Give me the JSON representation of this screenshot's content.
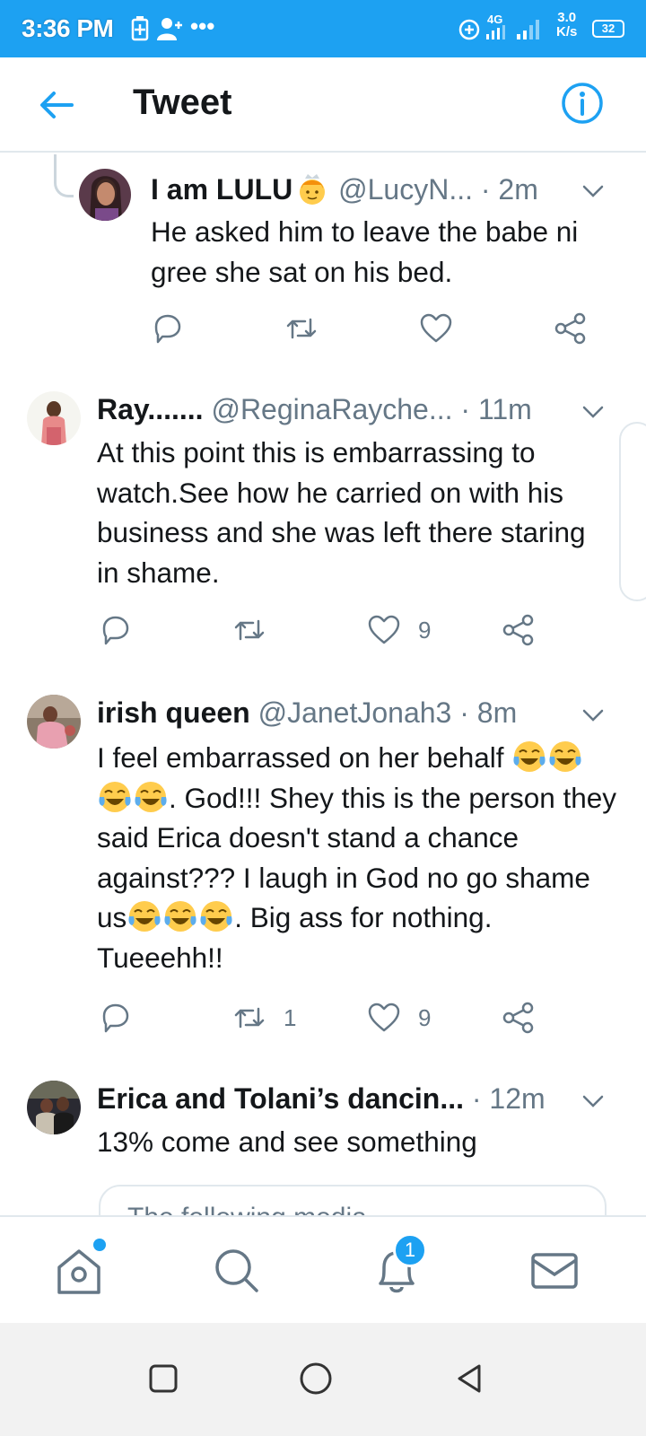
{
  "status_bar": {
    "time": "3:36 PM",
    "dots": "•••",
    "network": "4G",
    "speed_value": "3.0",
    "speed_unit": "K/s",
    "battery": "32"
  },
  "app_bar": {
    "title": "Tweet"
  },
  "tweets": [
    {
      "name": "I am LULU",
      "name_emoji": "princess-emoji",
      "handle": "@LucyN...",
      "time": "· 2m",
      "text": "He asked him to leave the babe ni gree she sat on his bed.",
      "replies": "",
      "retweets": "",
      "likes": ""
    },
    {
      "name": "Ray.......",
      "handle": "@ReginaRayche...",
      "time": "· 11m",
      "text": "At this point this is embarrassing to watch.See how he carried on with his business and she was left there staring in shame.",
      "replies": "",
      "retweets": "",
      "likes": "9"
    },
    {
      "name": "irish queen",
      "handle": "@JanetJonah3",
      "time": "· 8m",
      "text_parts": [
        "I feel embarrassed on her behalf ",
        ". God!!! Shey this is the person they said Erica doesn't stand a chance against??? I laugh in God no go shame us",
        ". Big ass for nothing. Tueeehh!!"
      ],
      "emoji_name": "face-with-tears-of-joy",
      "replies": "",
      "retweets": "1",
      "likes": "9"
    },
    {
      "name": "Erica and Tolani’s dancin...",
      "handle": "",
      "time": "· 12m",
      "text": "13% come and see something",
      "media_text": "The following media"
    }
  ],
  "bottom_nav": {
    "items": [
      "home",
      "search",
      "notifications",
      "messages"
    ],
    "notification_badge": "1"
  },
  "colors": {
    "accent": "#1da1f2",
    "secondary_text": "#657786",
    "primary_text": "#14171a",
    "border": "#e1e8ed"
  }
}
